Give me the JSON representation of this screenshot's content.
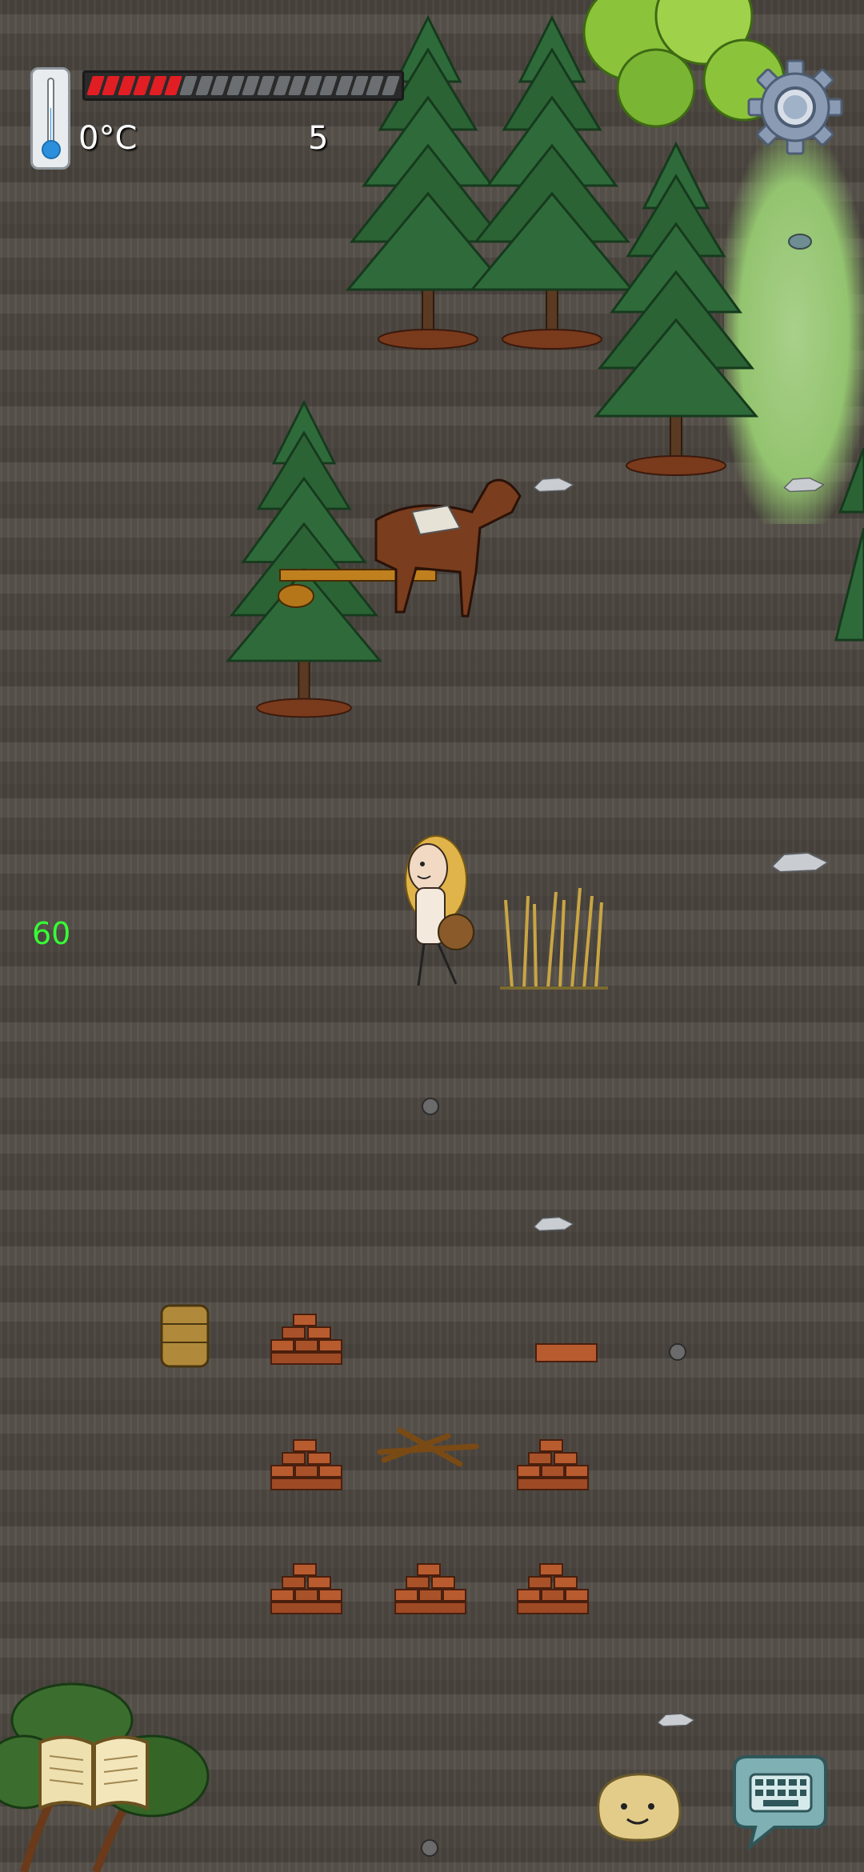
{
  "hud": {
    "temperature_label": "0°C",
    "temperature_fraction": 0.55,
    "thermometer_icon": "thermometer-icon",
    "food_bar": {
      "segments_total": 20,
      "segments_filled": 6,
      "filled_color": "#e01e24",
      "empty_color": "#6b6f72"
    },
    "food_count": "5",
    "fps": "60",
    "settings_icon": "gear-icon"
  },
  "bottom_bar": {
    "book_icon": "recipe-book-icon",
    "emote_icon": "smiley-face-icon",
    "chat_icon": "keyboard-chat-icon"
  },
  "scene": {
    "ground_color": "#4f4943",
    "grass_color": "#93c46f",
    "objects": [
      "pine-tree",
      "pine-tree",
      "pine-tree",
      "broadleaf-tree",
      "pine-tree",
      "horse-cart",
      "player-character",
      "wheat-plant",
      "stone",
      "flint",
      "basket",
      "adobe-pile",
      "kindling",
      "round-stone",
      "bush-tree"
    ]
  }
}
